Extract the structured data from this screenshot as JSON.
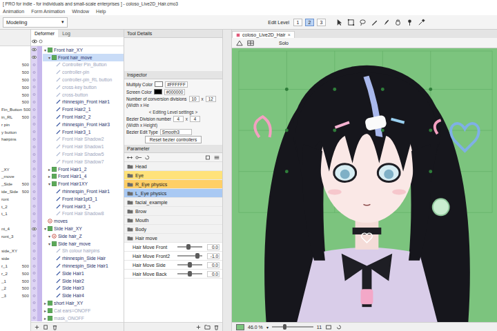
{
  "window": {
    "title": "[ PRO for indie - for individuals and small-scale enterprises ] - coloso_Live2D_Hair.cmo3"
  },
  "menu": [
    "Animation",
    "Form Animation",
    "Window",
    "Help"
  ],
  "toolbar": {
    "mode": "Modeling",
    "mode_arrow": "▾",
    "edit_level_label": "Edit Level",
    "edit_levels": [
      {
        "label": "1",
        "selected": false
      },
      {
        "label": "2",
        "selected": true
      },
      {
        "label": "3",
        "selected": false
      }
    ]
  },
  "left_panel": {
    "rows": [
      {
        "text": "",
        "value": ""
      },
      {
        "text": "",
        "value": ""
      },
      {
        "text": "",
        "value": "500"
      },
      {
        "text": "",
        "value": "500"
      },
      {
        "text": "",
        "value": "500"
      },
      {
        "text": "",
        "value": "500"
      },
      {
        "text": "",
        "value": "500"
      },
      {
        "text": "",
        "value": "500"
      },
      {
        "text": "Fin_Button",
        "value": "500"
      },
      {
        "text": "in_RL",
        "value": "500"
      },
      {
        "text": "r pin",
        "value": ""
      },
      {
        "text": "y button",
        "value": ""
      },
      {
        "text": "hairpins",
        "value": ""
      },
      {
        "text": "",
        "value": ""
      },
      {
        "text": "",
        "value": ""
      },
      {
        "text": "",
        "value": ""
      },
      {
        "text": "_XY",
        "value": ""
      },
      {
        "text": "_move",
        "value": ""
      },
      {
        "text": "_Side",
        "value": "500"
      },
      {
        "text": "ide_Side",
        "value": "500"
      },
      {
        "text": "ront",
        "value": ""
      },
      {
        "text": "t_2",
        "value": ""
      },
      {
        "text": "t_1",
        "value": ""
      },
      {
        "text": "",
        "value": ""
      },
      {
        "text": "nt_4",
        "value": ""
      },
      {
        "text": "ront_3",
        "value": ""
      },
      {
        "text": "",
        "value": ""
      },
      {
        "text": "side_XY",
        "value": ""
      },
      {
        "text": "side",
        "value": ""
      },
      {
        "text": "r_1",
        "value": "500"
      },
      {
        "text": "r_2",
        "value": "500"
      },
      {
        "text": "_1",
        "value": "500"
      },
      {
        "text": "_2",
        "value": "500"
      },
      {
        "text": "_3",
        "value": "500"
      },
      {
        "text": "",
        "value": ""
      },
      {
        "text": "",
        "value": ""
      },
      {
        "text": "",
        "value": ""
      }
    ]
  },
  "deformer_panel": {
    "tabs": [
      {
        "label": "Deformer",
        "selected": true
      },
      {
        "label": "Log",
        "selected": false
      }
    ],
    "rows": [
      {
        "label": "Front hair_XY",
        "kind": "warp",
        "depth": 0,
        "toggle": "▾",
        "visible": true,
        "selected": false,
        "dimmed": false
      },
      {
        "label": "Front hair_move",
        "kind": "warp",
        "depth": 1,
        "toggle": "▾",
        "visible": true,
        "selected": true,
        "dimmed": false
      },
      {
        "label": "Controller Pin_Button",
        "kind": "mesh",
        "depth": 2,
        "toggle": "",
        "visible": false,
        "selected": false,
        "dimmed": true
      },
      {
        "label": "controller-pin",
        "kind": "mesh",
        "depth": 2,
        "toggle": "",
        "visible": false,
        "selected": false,
        "dimmed": true
      },
      {
        "label": "controller-pin_RL button",
        "kind": "mesh",
        "depth": 2,
        "toggle": "",
        "visible": false,
        "selected": false,
        "dimmed": true
      },
      {
        "label": "cross-key button",
        "kind": "mesh",
        "depth": 2,
        "toggle": "",
        "visible": false,
        "selected": false,
        "dimmed": true
      },
      {
        "label": "cross-button",
        "kind": "mesh",
        "depth": 2,
        "toggle": "",
        "visible": false,
        "selected": false,
        "dimmed": true
      },
      {
        "label": "rhinnespin_Front Hair1",
        "kind": "mesh",
        "depth": 2,
        "toggle": "",
        "visible": false,
        "selected": false,
        "dimmed": false
      },
      {
        "label": "Front Hair2_1",
        "kind": "mesh",
        "depth": 2,
        "toggle": "",
        "visible": false,
        "selected": false,
        "dimmed": false
      },
      {
        "label": "Front Hair2_2",
        "kind": "mesh",
        "depth": 2,
        "toggle": "",
        "visible": false,
        "selected": false,
        "dimmed": false
      },
      {
        "label": "rhinnespin_Front Hair3",
        "kind": "mesh",
        "depth": 2,
        "toggle": "",
        "visible": false,
        "selected": false,
        "dimmed": false
      },
      {
        "label": "Front Hair3_1",
        "kind": "mesh",
        "depth": 2,
        "toggle": "",
        "visible": false,
        "selected": false,
        "dimmed": false
      },
      {
        "label": "Front Hair Shadow2",
        "kind": "mesh",
        "depth": 2,
        "toggle": "",
        "visible": false,
        "selected": false,
        "dimmed": true
      },
      {
        "label": "Front Hair Shadow1",
        "kind": "mesh",
        "depth": 2,
        "toggle": "",
        "visible": false,
        "selected": false,
        "dimmed": true
      },
      {
        "label": "Front Hair Shadow5",
        "kind": "mesh",
        "depth": 2,
        "toggle": "",
        "visible": false,
        "selected": false,
        "dimmed": true
      },
      {
        "label": "Front Hair Shadow7",
        "kind": "mesh",
        "depth": 2,
        "toggle": "",
        "visible": false,
        "selected": false,
        "dimmed": true
      },
      {
        "label": "Front Hair1_2",
        "kind": "warp",
        "depth": 1,
        "toggle": "▸",
        "visible": false,
        "selected": false,
        "dimmed": false
      },
      {
        "label": "Front Hair1_4",
        "kind": "warp",
        "depth": 1,
        "toggle": "▸",
        "visible": false,
        "selected": false,
        "dimmed": false
      },
      {
        "label": "Front Hair1XY",
        "kind": "warp",
        "depth": 1,
        "toggle": "▾",
        "visible": false,
        "selected": false,
        "dimmed": false
      },
      {
        "label": "rhinnespin_Front Hair1",
        "kind": "mesh",
        "depth": 2,
        "toggle": "",
        "visible": false,
        "selected": false,
        "dimmed": false
      },
      {
        "label": "Front Hair1pt3_1",
        "kind": "mesh",
        "depth": 2,
        "toggle": "",
        "visible": false,
        "selected": false,
        "dimmed": false
      },
      {
        "label": "Front Hair3_1",
        "kind": "mesh",
        "depth": 2,
        "toggle": "",
        "visible": false,
        "selected": false,
        "dimmed": false
      },
      {
        "label": "Front Hair Shadow8",
        "kind": "mesh",
        "depth": 2,
        "toggle": "",
        "visible": false,
        "selected": false,
        "dimmed": true
      },
      {
        "label": "moves",
        "kind": "rotation",
        "depth": 0,
        "toggle": "",
        "visible": false,
        "selected": false,
        "dimmed": false
      },
      {
        "label": "Side Hair_XY",
        "kind": "warp",
        "depth": 0,
        "toggle": "▾",
        "visible": true,
        "selected": false,
        "dimmed": false
      },
      {
        "label": "Side hair_Z",
        "kind": "rotation",
        "depth": 1,
        "toggle": "▾",
        "visible": false,
        "selected": false,
        "dimmed": false
      },
      {
        "label": "Side hair_move",
        "kind": "warp",
        "depth": 1,
        "toggle": "▾",
        "visible": false,
        "selected": false,
        "dimmed": false
      },
      {
        "label": "Sh colour hairpins",
        "kind": "mesh",
        "depth": 2,
        "toggle": "",
        "visible": false,
        "selected": false,
        "dimmed": true
      },
      {
        "label": "rhinnespin_Side Hair",
        "kind": "mesh",
        "depth": 2,
        "toggle": "",
        "visible": false,
        "selected": false,
        "dimmed": false
      },
      {
        "label": "rhinnespin_Side Hair1",
        "kind": "mesh",
        "depth": 2,
        "toggle": "",
        "visible": false,
        "selected": false,
        "dimmed": false
      },
      {
        "label": "Side Hair1",
        "kind": "mesh",
        "depth": 2,
        "toggle": "",
        "visible": false,
        "selected": false,
        "dimmed": false
      },
      {
        "label": "Side Hair2",
        "kind": "mesh",
        "depth": 2,
        "toggle": "",
        "visible": false,
        "selected": false,
        "dimmed": false
      },
      {
        "label": "Side Hair3",
        "kind": "mesh",
        "depth": 2,
        "toggle": "",
        "visible": false,
        "selected": false,
        "dimmed": false
      },
      {
        "label": "Side Hair4",
        "kind": "mesh",
        "depth": 2,
        "toggle": "",
        "visible": false,
        "selected": false,
        "dimmed": false
      },
      {
        "label": "short Hair_XY",
        "kind": "warp",
        "depth": 0,
        "toggle": "▸",
        "visible": false,
        "selected": false,
        "dimmed": false
      },
      {
        "label": "Cat ears=ONOFF",
        "kind": "warp",
        "depth": 0,
        "toggle": "▸",
        "visible": false,
        "selected": false,
        "dimmed": true
      },
      {
        "label": "mask_ONOFF",
        "kind": "warp",
        "depth": 0,
        "toggle": "▸",
        "visible": false,
        "selected": false,
        "dimmed": true
      }
    ]
  },
  "tool_details": {
    "title": "Tool Details"
  },
  "inspector": {
    "title": "Inspector",
    "rows": [
      {
        "kind": "color",
        "label": "Multiply Color",
        "value": "#FFFFFF",
        "color": "#ffffff"
      },
      {
        "kind": "color",
        "label": "Screen Color",
        "value": "#000000",
        "color": "#000000"
      },
      {
        "kind": "divisions",
        "label": "Number of conversion divisions",
        "w": "10",
        "x": "x",
        "h": "12",
        "note": "(Width x He"
      },
      {
        "kind": "heading",
        "label": "< Editing Level settings >"
      },
      {
        "kind": "divisions",
        "label": "Bezier Division number",
        "w": "4",
        "x": "x",
        "h": "4",
        "note": "(Width x Height)"
      },
      {
        "kind": "select",
        "label": "Bezier Edit Type",
        "value": "Smooth3"
      },
      {
        "kind": "button",
        "label": "Reset bezier controllers"
      }
    ]
  },
  "parameter": {
    "title": "Parameter",
    "items": [
      {
        "kind": "group",
        "label": "Head",
        "color": "#f2f2f2"
      },
      {
        "kind": "group",
        "label": "Eye",
        "color": "#ffe27a"
      },
      {
        "kind": "group",
        "label": "R_Eye physics",
        "color": "#ffcf66"
      },
      {
        "kind": "group",
        "label": "L_Eye physics",
        "color": "#a9c9f3"
      },
      {
        "kind": "group",
        "label": "facial_example",
        "color": "#f2f2f2"
      },
      {
        "kind": "group",
        "label": "Brow",
        "color": "#f2f2f2"
      },
      {
        "kind": "group",
        "label": "Mouth",
        "color": "#f2f2f2"
      },
      {
        "kind": "group",
        "label": "Body",
        "color": "#f2f2f2"
      },
      {
        "kind": "group",
        "label": "Hair move",
        "color": "#f2f2f2"
      },
      {
        "kind": "slider",
        "label": "Hair Move Front",
        "level": 0.45,
        "value": "0.0"
      },
      {
        "kind": "slider",
        "label": "Hair Move Front2",
        "level": 0.8,
        "value": "-1.0"
      },
      {
        "kind": "slider",
        "label": "Hair Move Side",
        "level": 0.5,
        "value": "0.0"
      },
      {
        "kind": "slider",
        "label": "Hair Move Back",
        "level": 0.5,
        "value": "0.0"
      }
    ]
  },
  "canvas": {
    "tab": "coloso_Live2D_Hair",
    "close": "×",
    "solo": "Solo",
    "zoom": "46.0 %",
    "zoom_arrow": "▾",
    "zoom_level": 0.3,
    "frame": "11"
  }
}
